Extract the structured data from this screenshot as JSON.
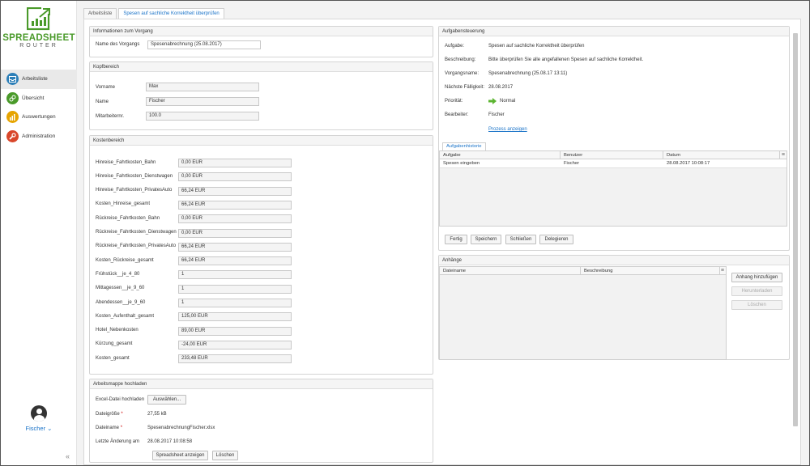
{
  "app": {
    "logo_text_main": "SPREADSHEET",
    "logo_text_sub": "ROUTER",
    "brand_color": "#4a9a2a"
  },
  "sidebar": {
    "items": [
      {
        "label": "Arbeitsliste",
        "icon": "inbox-icon",
        "color": "#2d7fb8",
        "active": true
      },
      {
        "label": "Übersicht",
        "icon": "link-icon",
        "color": "#4a9a2a",
        "active": false
      },
      {
        "label": "Auswertungen",
        "icon": "bar-chart-icon",
        "color": "#e6a400",
        "active": false
      },
      {
        "label": "Administration",
        "icon": "wrench-icon",
        "color": "#d9472b",
        "active": false
      }
    ],
    "user_name": "Fischer ⌄",
    "collapse_label": "«"
  },
  "tabs": [
    {
      "label": "Arbeitsliste",
      "active": false
    },
    {
      "label": "Spesen auf sachliche Korrektheit überprüfen",
      "active": true
    }
  ],
  "info": {
    "title": "Informationen zum Vorgang",
    "label": "Name des Vorgangs",
    "value": "Spesenabrechnung (25.08.2017)"
  },
  "kopf": {
    "title": "Kopfbereich",
    "fields": [
      {
        "label": "Vorname",
        "value": "Max"
      },
      {
        "label": "Name",
        "value": "Fischer"
      },
      {
        "label": "Mitarbeiternr.",
        "value": "100.0"
      }
    ]
  },
  "kosten": {
    "title": "Kostenbereich",
    "fields": [
      {
        "label": "Hinreise_Fahrtkosten_Bahn",
        "value": "0,00 EUR"
      },
      {
        "label": "Hinreise_Fahrtkosten_Dienstwagen",
        "value": "0,00 EUR"
      },
      {
        "label": "Hinreise_Fahrtkosten_PrivatesAuto",
        "value": "66,24 EUR"
      },
      {
        "label": "Kosten_Hinreise_gesamt",
        "value": "66,24 EUR"
      },
      {
        "label": "Rückreise_Fahrtkosten_Bahn",
        "value": "0,00 EUR"
      },
      {
        "label": "Rückreise_Fahrtkosten_Dienstwagen",
        "value": "0,00 EUR"
      },
      {
        "label": "Rückreise_Fahrtkosten_PrivatesAuto",
        "value": "66,24 EUR"
      },
      {
        "label": "Kosten_Rückreise_gesamt",
        "value": "66,24 EUR"
      },
      {
        "label": "Frühstück__je_4_80",
        "value": "1"
      },
      {
        "label": "Mittagessen__je_9_60",
        "value": "1"
      },
      {
        "label": "Abendessen__je_9_60",
        "value": "1"
      },
      {
        "label": "Kosten_Aufenthalt_gesamt",
        "value": "125,00 EUR"
      },
      {
        "label": "Hotel_Nebenkosten",
        "value": "89,00 EUR"
      },
      {
        "label": "Kürzung_gesamt",
        "value": "-24,00 EUR"
      },
      {
        "label": "Kosten_gesamt",
        "value": "233,48 EUR"
      }
    ]
  },
  "upload": {
    "title": "Arbeitsmappe hochladen",
    "file_label": "Excel-Datei hochladen",
    "choose_button": "Auswählen...",
    "size_label": "Dateigröße",
    "size_value": "27,55 kB",
    "name_label": "Dateiname",
    "name_value": "SpesenabrechnungFischer.xlsx",
    "changed_label": "Letzte Änderung am",
    "changed_value": "28.08.2017 10:08:58",
    "required_mark": "*",
    "show_button": "Spreadsheet anzeigen",
    "delete_button": "Löschen"
  },
  "task": {
    "title": "Aufgabensteuerung",
    "rows": [
      {
        "label": "Aufgabe:",
        "value": "Spesen auf sachliche Korrektheit überprüfen"
      },
      {
        "label": "Beschreibung:",
        "value": "Bitte überprüfen Sie alle angefallenen Spesen auf sachliche Korrektheit."
      },
      {
        "label": "Vorgangsname:",
        "value": "Spesenabrechnung (25.08.17 13:11)"
      },
      {
        "label": "Nächste Fälligkeit:",
        "value": "28.08.2017"
      },
      {
        "label": "Priorität:",
        "value": "Normal"
      },
      {
        "label": "Bearbeiter:",
        "value": "Fischer"
      }
    ],
    "process_link": "Prozess anzeigen",
    "history_tab": "Aufgabenhistorie",
    "history_columns": [
      "Aufgabe",
      "Benutzer",
      "Datum"
    ],
    "history_rows": [
      [
        "Spesen eingeben",
        "Fischer",
        "28.08.2017 10:08:17"
      ]
    ],
    "buttons": [
      "Fertig",
      "Speichern",
      "Schließen",
      "Delegieren"
    ]
  },
  "attach": {
    "title": "Anhänge",
    "columns": [
      "Dateiname",
      "Beschreibung"
    ],
    "add_button": "Anhang hinzufügen",
    "download_button": "Herunterladen",
    "delete_button": "Löschen"
  }
}
